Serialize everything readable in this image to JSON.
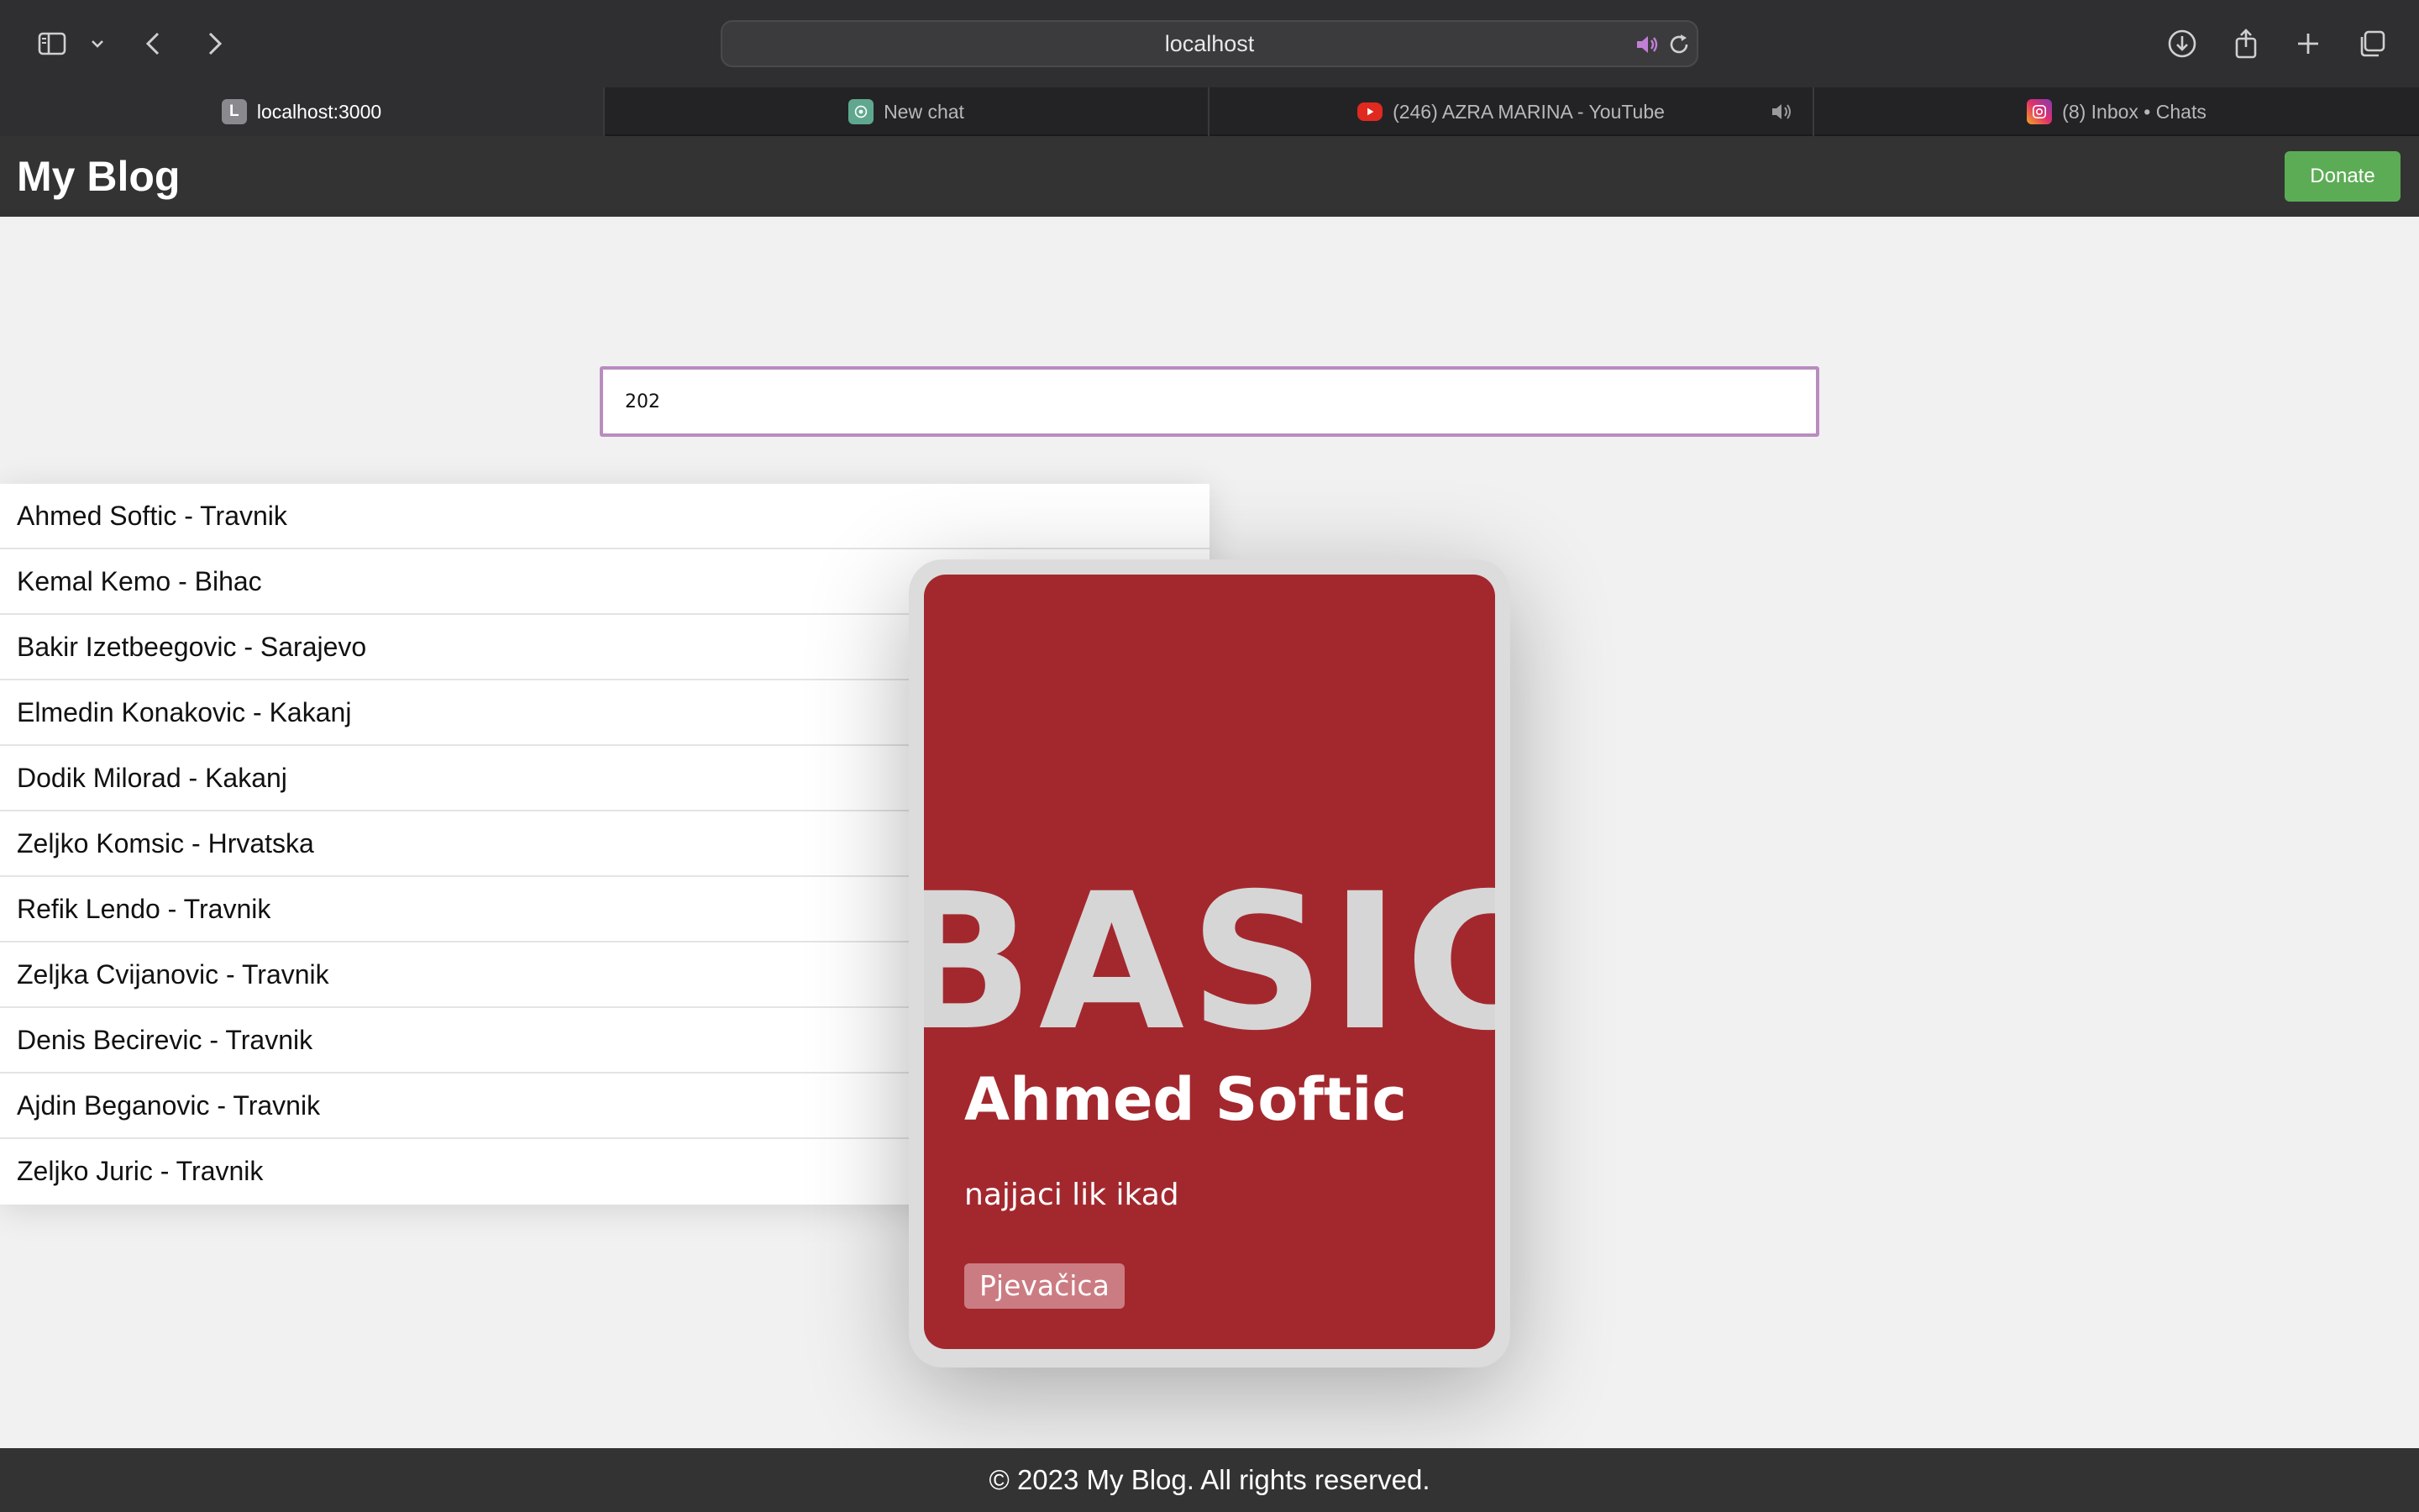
{
  "browser": {
    "url": "localhost",
    "tabs": [
      {
        "title": "localhost:3000",
        "favicon": "L",
        "active": true
      },
      {
        "title": "New chat",
        "favicon": "chatgpt-icon",
        "active": false
      },
      {
        "title": "(246) AZRA MARINA - YouTube",
        "favicon": "youtube-icon",
        "active": false,
        "audio": true
      },
      {
        "title": "(8) Inbox • Chats",
        "favicon": "instagram-icon",
        "active": false
      }
    ]
  },
  "header": {
    "title": "My Blog",
    "donate_label": "Donate"
  },
  "search": {
    "value": "202"
  },
  "list": {
    "items": [
      "Ahmed Softic - Travnik",
      "Kemal Kemo - Bihac",
      "Bakir Izetbeegovic - Sarajevo",
      "Elmedin Konakovic - Kakanj",
      "Dodik Milorad - Kakanj",
      "Zeljko Komsic - Hrvatska",
      "Refik Lendo - Travnik",
      "Zeljka Cvijanovic - Travnik",
      "Denis Becirevic - Travnik",
      "Ajdin Beganovic - Travnik",
      "Zeljko Juric - Travnik"
    ]
  },
  "card": {
    "background_text": "BASIC",
    "name": "Ahmed Softic",
    "description": "najjaci lik ikad",
    "tag": "Pjevačica",
    "color": "#a3282e"
  },
  "footer": {
    "text": "© 2023 My Blog. All rights reserved."
  },
  "colors": {
    "header_bg": "#333333",
    "donate": "#5cac55",
    "search_border": "#b98cc0",
    "speaker_accent": "#c17fd6"
  }
}
